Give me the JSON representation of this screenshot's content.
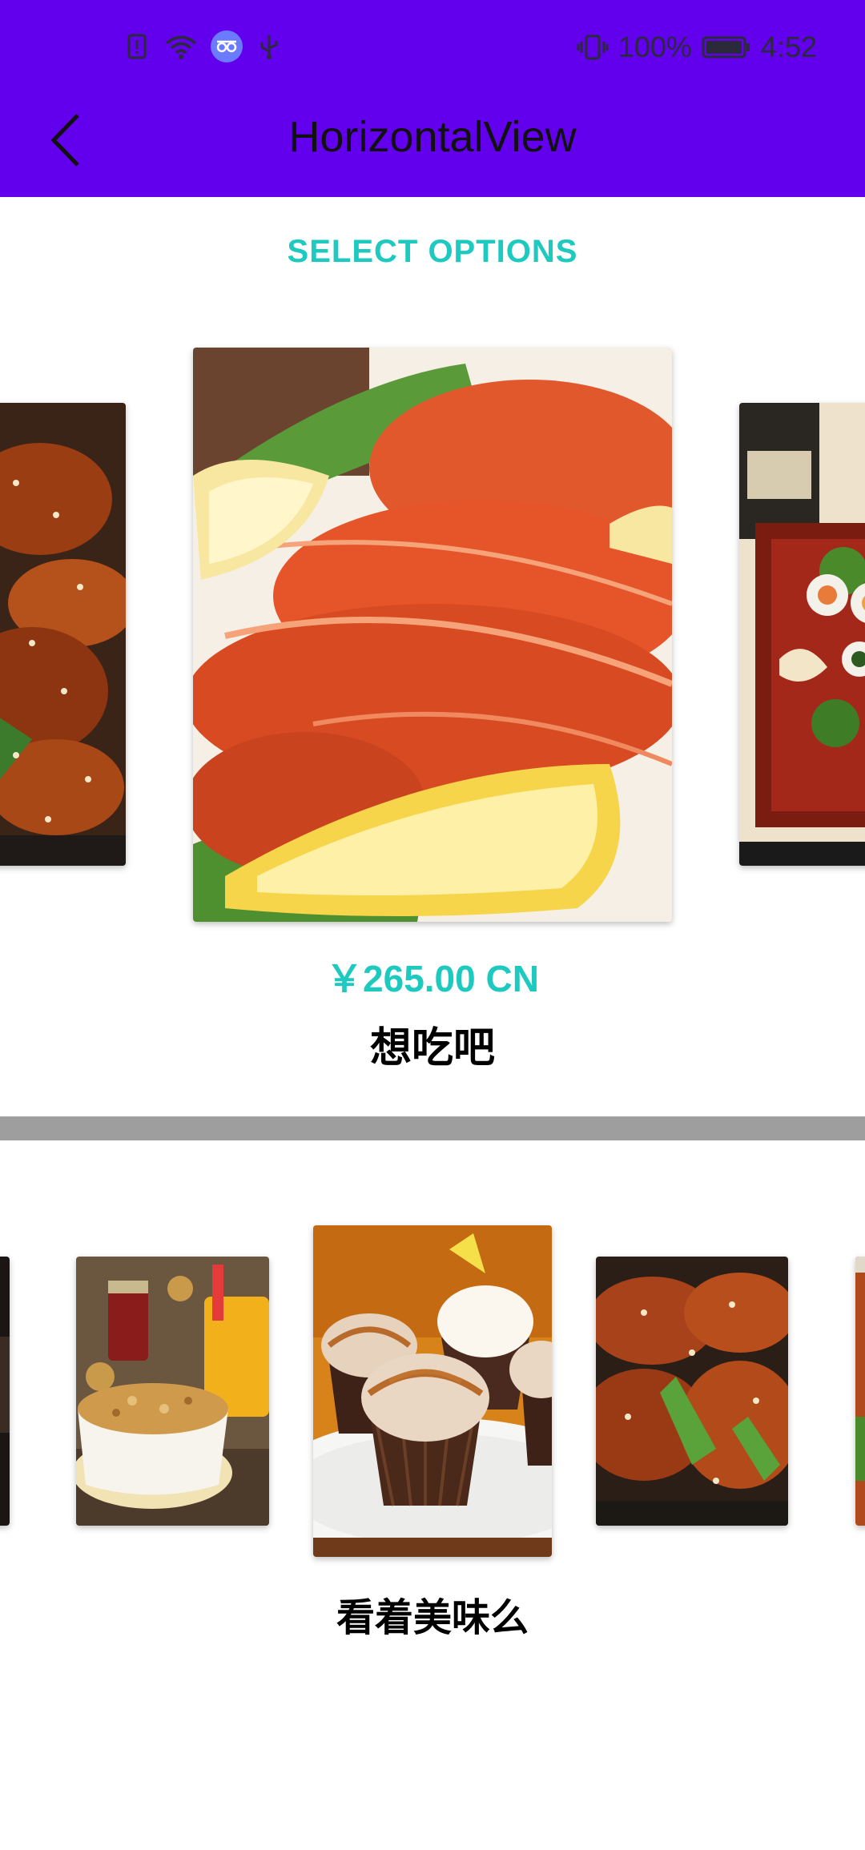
{
  "status_bar": {
    "battery_percent": "100%",
    "time": "4:52",
    "icons": [
      "alert-icon",
      "wifi-icon",
      "assistant-icon",
      "usb-icon",
      "vibrate-icon",
      "battery-icon"
    ]
  },
  "app_bar": {
    "title": "HorizontalView",
    "back_icon": "chevron-left-icon",
    "background_color": "#6200ee"
  },
  "section_header": "SELECT OPTIONS",
  "carousel_top": {
    "selected": {
      "price": "￥265.00 CN",
      "name": "想吃吧"
    },
    "images": [
      {
        "description": "glazed chicken wings",
        "position": "left-partial"
      },
      {
        "description": "grilled prawns with lemon",
        "position": "center"
      },
      {
        "description": "sushi with wine bottle",
        "position": "right-partial"
      }
    ]
  },
  "carousel_bottom": {
    "selected_caption": "看着美味么",
    "images": [
      {
        "description": "dark item",
        "position": "far-left-partial"
      },
      {
        "description": "cereal bowl with juice",
        "position": "left"
      },
      {
        "description": "cupcakes",
        "position": "center"
      },
      {
        "description": "chicken wings",
        "position": "right"
      },
      {
        "description": "food",
        "position": "far-right-partial"
      }
    ]
  },
  "accent_color": "#1ec9bf",
  "divider_color": "#9e9e9e"
}
